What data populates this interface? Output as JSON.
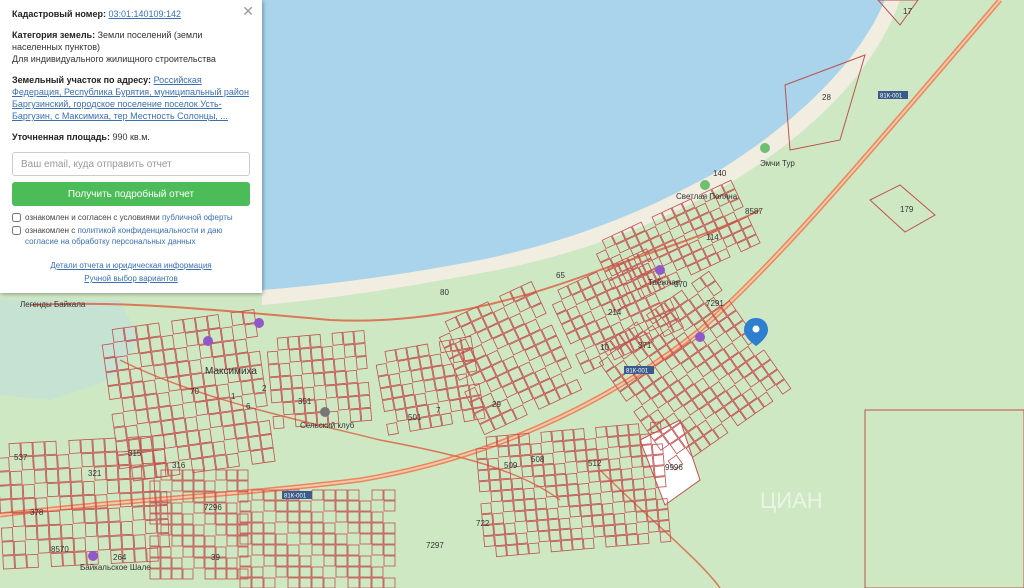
{
  "panel": {
    "cadastral_label": "Кадастровый номер:",
    "cadastral_number": "03:01:140109:142",
    "category_label": "Категория земель:",
    "category_value": "Земли поселений (земли населенных пунктов)",
    "usage_value": "Для индивидуального жилищного строительства",
    "address_label": "Земельный участок по адресу:",
    "address_value": "Российская Федерация, Республика Бурятия, муниципальный район Баргузинский, городское поселение поселок Усть-Баргузин, с Максимиха, тер Местность Солонцы, ...",
    "area_label": "Уточненная площадь:",
    "area_value": "990 кв.м.",
    "email_placeholder": "Ваш email, куда отправить отчет",
    "submit_label": "Получить подробный отчет",
    "check1_text": "ознакомлен и согласен с условиями",
    "check1_link": "публичной оферты",
    "check2_text": "ознакомлен с",
    "check2_link": "политикой конфиденциальности и даю согласие на обработку персональных данных",
    "details_link": "Детали отчета и юридическая информация",
    "manual_link": "Ручной выбор вариантов",
    "close_icon": "close-icon"
  },
  "map": {
    "place_maksimikha": "Максимиха",
    "place_legend": "Легенды Байкала",
    "place_club": "Сельский клуб",
    "place_baikal_chalet": "Байкальское Шале",
    "place_emchi": "Эмчи Тур",
    "place_svetlaya": "Светлая Поляна",
    "place_tayozhnaya": "Таёжная",
    "road_tag_1": "81К-001",
    "road_tag_2": "81К-001",
    "road_tag_3": "81К-001",
    "watermark": "ЦИАН",
    "parcel_labels": [
      "17",
      "28",
      "140",
      "8587",
      "179",
      "114",
      "65",
      "80",
      "214",
      "371",
      "7291",
      "351",
      "501",
      "7",
      "29",
      "537",
      "321",
      "315",
      "316",
      "378",
      "7296",
      "8570",
      "264",
      "39",
      "7297",
      "722",
      "509",
      "508",
      "512",
      "9996",
      "6",
      "1",
      "2",
      "10",
      "70",
      "370"
    ],
    "marker_icon": "location-pin-icon",
    "colors": {
      "water": "#a9d4ec",
      "land": "#cfe8c4",
      "road": "#e8875a",
      "parcel": "#c0504d",
      "panel_button": "#4cbc59"
    }
  }
}
